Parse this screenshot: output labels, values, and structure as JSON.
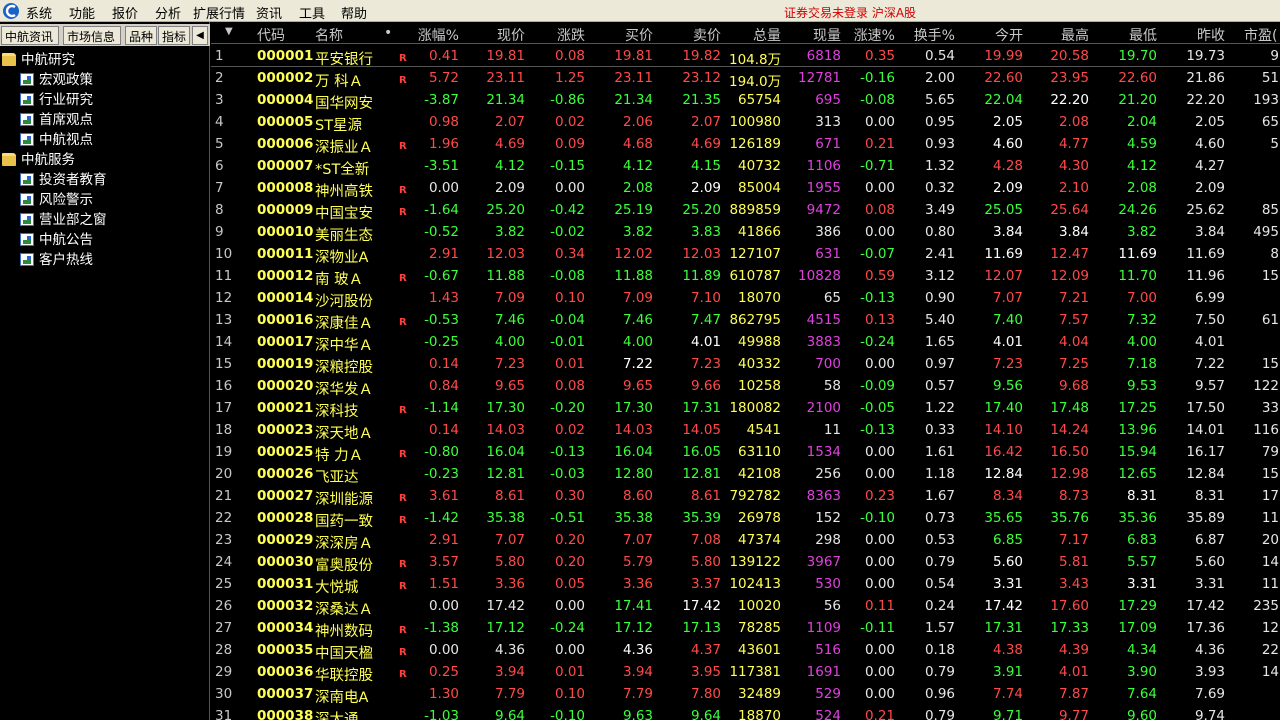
{
  "menubar": {
    "items": [
      "系统",
      "功能",
      "报价",
      "分析",
      "扩展行情",
      "资讯",
      "工具",
      "帮助"
    ],
    "status_text": "证券交易未登录  沪深A股"
  },
  "left_panel": {
    "tabs": [
      "中航资讯",
      "市场信息",
      "品种",
      "指标"
    ],
    "scroll_arrow": "◀",
    "tree": [
      {
        "label": "中航研究",
        "level": 0,
        "icon": "folder-icon"
      },
      {
        "label": "宏观政策",
        "level": 1,
        "icon": "document-icon"
      },
      {
        "label": "行业研究",
        "level": 1,
        "icon": "document-icon"
      },
      {
        "label": "首席观点",
        "level": 1,
        "icon": "document-icon"
      },
      {
        "label": "中航视点",
        "level": 1,
        "icon": "document-icon"
      },
      {
        "label": "中航服务",
        "level": 0,
        "icon": "folder-icon"
      },
      {
        "label": "投资者教育",
        "level": 1,
        "icon": "document-icon"
      },
      {
        "label": "风险警示",
        "level": 1,
        "icon": "document-icon"
      },
      {
        "label": "营业部之窗",
        "level": 1,
        "icon": "document-icon"
      },
      {
        "label": "中航公告",
        "level": 1,
        "icon": "document-icon"
      },
      {
        "label": "客户热线",
        "level": 1,
        "icon": "document-icon"
      }
    ]
  },
  "grid": {
    "sort_indicator": "▼",
    "headers": [
      "代码",
      "名称",
      "•",
      "涨幅%",
      "现价",
      "涨跌",
      "买价",
      "卖价",
      "总量",
      "现量",
      "涨速%",
      "换手%",
      "今开",
      "最高",
      "最低",
      "昨收",
      "市盈("
    ],
    "rows": [
      {
        "idx": "1",
        "code": "000001",
        "name": "平安银行",
        "mark": "R",
        "pct": "0.41",
        "price": "19.81",
        "chg": "0.08",
        "bid": "19.81",
        "ask": "19.82",
        "vol": "104.8万",
        "cur": "6818",
        "speed": "0.35",
        "turn": "0.54",
        "open": "19.99",
        "high": "20.58",
        "low": "19.70",
        "prev": "19.73",
        "pe": "9"
      },
      {
        "idx": "2",
        "code": "000002",
        "name": "万 科Ａ",
        "mark": "R",
        "pct": "5.72",
        "price": "23.11",
        "chg": "1.25",
        "bid": "23.11",
        "ask": "23.12",
        "vol": "194.0万",
        "cur": "12781",
        "speed": "-0.16",
        "turn": "2.00",
        "open": "22.60",
        "high": "23.95",
        "low": "22.60",
        "prev": "21.86",
        "pe": "51"
      },
      {
        "idx": "3",
        "code": "000004",
        "name": "国华网安",
        "mark": "",
        "pct": "-3.87",
        "price": "21.34",
        "chg": "-0.86",
        "bid": "21.34",
        "ask": "21.35",
        "vol": "65754",
        "cur": "695",
        "speed": "-0.08",
        "turn": "5.65",
        "open": "22.04",
        "high": "22.20",
        "low": "21.20",
        "prev": "22.20",
        "pe": "193"
      },
      {
        "idx": "4",
        "code": "000005",
        "name": "ST星源",
        "mark": "",
        "pct": "0.98",
        "price": "2.07",
        "chg": "0.02",
        "bid": "2.06",
        "ask": "2.07",
        "vol": "100980",
        "cur": "313",
        "speed": "0.00",
        "turn": "0.95",
        "open": "2.05",
        "high": "2.08",
        "low": "2.04",
        "prev": "2.05",
        "pe": "65"
      },
      {
        "idx": "5",
        "code": "000006",
        "name": "深振业Ａ",
        "mark": "R",
        "pct": "1.96",
        "price": "4.69",
        "chg": "0.09",
        "bid": "4.68",
        "ask": "4.69",
        "vol": "126189",
        "cur": "671",
        "speed": "0.21",
        "turn": "0.93",
        "open": "4.60",
        "high": "4.77",
        "low": "4.59",
        "prev": "4.60",
        "pe": "5"
      },
      {
        "idx": "6",
        "code": "000007",
        "name": "*ST全新",
        "mark": "",
        "pct": "-3.51",
        "price": "4.12",
        "chg": "-0.15",
        "bid": "4.12",
        "ask": "4.15",
        "vol": "40732",
        "cur": "1106",
        "speed": "-0.71",
        "turn": "1.32",
        "open": "4.28",
        "high": "4.30",
        "low": "4.12",
        "prev": "4.27",
        "pe": ""
      },
      {
        "idx": "7",
        "code": "000008",
        "name": "神州高铁",
        "mark": "R",
        "pct": "0.00",
        "price": "2.09",
        "chg": "0.00",
        "bid": "2.08",
        "ask": "2.09",
        "vol": "85004",
        "cur": "1955",
        "speed": "0.00",
        "turn": "0.32",
        "open": "2.09",
        "high": "2.10",
        "low": "2.08",
        "prev": "2.09",
        "pe": ""
      },
      {
        "idx": "8",
        "code": "000009",
        "name": "中国宝安",
        "mark": "R",
        "pct": "-1.64",
        "price": "25.20",
        "chg": "-0.42",
        "bid": "25.19",
        "ask": "25.20",
        "vol": "889859",
        "cur": "9472",
        "speed": "0.08",
        "turn": "3.49",
        "open": "25.05",
        "high": "25.64",
        "low": "24.26",
        "prev": "25.62",
        "pe": "85"
      },
      {
        "idx": "9",
        "code": "000010",
        "name": "美丽生态",
        "mark": "",
        "pct": "-0.52",
        "price": "3.82",
        "chg": "-0.02",
        "bid": "3.82",
        "ask": "3.83",
        "vol": "41866",
        "cur": "386",
        "speed": "0.00",
        "turn": "0.80",
        "open": "3.84",
        "high": "3.84",
        "low": "3.82",
        "prev": "3.84",
        "pe": "495"
      },
      {
        "idx": "10",
        "code": "000011",
        "name": "深物业A",
        "mark": "",
        "pct": "2.91",
        "price": "12.03",
        "chg": "0.34",
        "bid": "12.02",
        "ask": "12.03",
        "vol": "127107",
        "cur": "631",
        "speed": "-0.07",
        "turn": "2.41",
        "open": "11.69",
        "high": "12.47",
        "low": "11.69",
        "prev": "11.69",
        "pe": "8"
      },
      {
        "idx": "11",
        "code": "000012",
        "name": "南 玻Ａ",
        "mark": "R",
        "pct": "-0.67",
        "price": "11.88",
        "chg": "-0.08",
        "bid": "11.88",
        "ask": "11.89",
        "vol": "610787",
        "cur": "10828",
        "speed": "0.59",
        "turn": "3.12",
        "open": "12.07",
        "high": "12.09",
        "low": "11.70",
        "prev": "11.96",
        "pe": "15"
      },
      {
        "idx": "12",
        "code": "000014",
        "name": "沙河股份",
        "mark": "",
        "pct": "1.43",
        "price": "7.09",
        "chg": "0.10",
        "bid": "7.09",
        "ask": "7.10",
        "vol": "18070",
        "cur": "65",
        "speed": "-0.13",
        "turn": "0.90",
        "open": "7.07",
        "high": "7.21",
        "low": "7.00",
        "prev": "6.99",
        "pe": ""
      },
      {
        "idx": "13",
        "code": "000016",
        "name": "深康佳Ａ",
        "mark": "R",
        "pct": "-0.53",
        "price": "7.46",
        "chg": "-0.04",
        "bid": "7.46",
        "ask": "7.47",
        "vol": "862795",
        "cur": "4515",
        "speed": "0.13",
        "turn": "5.40",
        "open": "7.40",
        "high": "7.57",
        "low": "7.32",
        "prev": "7.50",
        "pe": "61"
      },
      {
        "idx": "14",
        "code": "000017",
        "name": "深中华Ａ",
        "mark": "",
        "pct": "-0.25",
        "price": "4.00",
        "chg": "-0.01",
        "bid": "4.00",
        "ask": "4.01",
        "vol": "49988",
        "cur": "3883",
        "speed": "-0.24",
        "turn": "1.65",
        "open": "4.01",
        "high": "4.04",
        "low": "4.00",
        "prev": "4.01",
        "pe": ""
      },
      {
        "idx": "15",
        "code": "000019",
        "name": "深粮控股",
        "mark": "",
        "pct": "0.14",
        "price": "7.23",
        "chg": "0.01",
        "bid": "7.22",
        "ask": "7.23",
        "vol": "40332",
        "cur": "700",
        "speed": "0.00",
        "turn": "0.97",
        "open": "7.23",
        "high": "7.25",
        "low": "7.18",
        "prev": "7.22",
        "pe": "15"
      },
      {
        "idx": "16",
        "code": "000020",
        "name": "深华发Ａ",
        "mark": "",
        "pct": "0.84",
        "price": "9.65",
        "chg": "0.08",
        "bid": "9.65",
        "ask": "9.66",
        "vol": "10258",
        "cur": "58",
        "speed": "-0.09",
        "turn": "0.57",
        "open": "9.56",
        "high": "9.68",
        "low": "9.53",
        "prev": "9.57",
        "pe": "122"
      },
      {
        "idx": "17",
        "code": "000021",
        "name": "深科技",
        "mark": "R",
        "pct": "-1.14",
        "price": "17.30",
        "chg": "-0.20",
        "bid": "17.30",
        "ask": "17.31",
        "vol": "180082",
        "cur": "2100",
        "speed": "-0.05",
        "turn": "1.22",
        "open": "17.40",
        "high": "17.48",
        "low": "17.25",
        "prev": "17.50",
        "pe": "33"
      },
      {
        "idx": "18",
        "code": "000023",
        "name": "深天地Ａ",
        "mark": "",
        "pct": "0.14",
        "price": "14.03",
        "chg": "0.02",
        "bid": "14.03",
        "ask": "14.05",
        "vol": "4541",
        "cur": "11",
        "speed": "-0.13",
        "turn": "0.33",
        "open": "14.10",
        "high": "14.24",
        "low": "13.96",
        "prev": "14.01",
        "pe": "116"
      },
      {
        "idx": "19",
        "code": "000025",
        "name": "特 力Ａ",
        "mark": "R",
        "pct": "-0.80",
        "price": "16.04",
        "chg": "-0.13",
        "bid": "16.04",
        "ask": "16.05",
        "vol": "63110",
        "cur": "1534",
        "speed": "0.00",
        "turn": "1.61",
        "open": "16.42",
        "high": "16.50",
        "low": "15.94",
        "prev": "16.17",
        "pe": "79"
      },
      {
        "idx": "20",
        "code": "000026",
        "name": "飞亚达",
        "mark": "",
        "pct": "-0.23",
        "price": "12.81",
        "chg": "-0.03",
        "bid": "12.80",
        "ask": "12.81",
        "vol": "42108",
        "cur": "256",
        "speed": "0.00",
        "turn": "1.18",
        "open": "12.84",
        "high": "12.98",
        "low": "12.65",
        "prev": "12.84",
        "pe": "15"
      },
      {
        "idx": "21",
        "code": "000027",
        "name": "深圳能源",
        "mark": "R",
        "pct": "3.61",
        "price": "8.61",
        "chg": "0.30",
        "bid": "8.60",
        "ask": "8.61",
        "vol": "792782",
        "cur": "8363",
        "speed": "0.23",
        "turn": "1.67",
        "open": "8.34",
        "high": "8.73",
        "low": "8.31",
        "prev": "8.31",
        "pe": "17"
      },
      {
        "idx": "22",
        "code": "000028",
        "name": "国药一致",
        "mark": "R",
        "pct": "-1.42",
        "price": "35.38",
        "chg": "-0.51",
        "bid": "35.38",
        "ask": "35.39",
        "vol": "26978",
        "cur": "152",
        "speed": "-0.10",
        "turn": "0.73",
        "open": "35.65",
        "high": "35.76",
        "low": "35.36",
        "prev": "35.89",
        "pe": "11"
      },
      {
        "idx": "23",
        "code": "000029",
        "name": "深深房Ａ",
        "mark": "",
        "pct": "2.91",
        "price": "7.07",
        "chg": "0.20",
        "bid": "7.07",
        "ask": "7.08",
        "vol": "47374",
        "cur": "298",
        "speed": "0.00",
        "turn": "0.53",
        "open": "6.85",
        "high": "7.17",
        "low": "6.83",
        "prev": "6.87",
        "pe": "20"
      },
      {
        "idx": "24",
        "code": "000030",
        "name": "富奥股份",
        "mark": "R",
        "pct": "3.57",
        "price": "5.80",
        "chg": "0.20",
        "bid": "5.79",
        "ask": "5.80",
        "vol": "139122",
        "cur": "3967",
        "speed": "0.00",
        "turn": "0.79",
        "open": "5.60",
        "high": "5.81",
        "low": "5.57",
        "prev": "5.60",
        "pe": "14"
      },
      {
        "idx": "25",
        "code": "000031",
        "name": "大悦城",
        "mark": "R",
        "pct": "1.51",
        "price": "3.36",
        "chg": "0.05",
        "bid": "3.36",
        "ask": "3.37",
        "vol": "102413",
        "cur": "530",
        "speed": "0.00",
        "turn": "0.54",
        "open": "3.31",
        "high": "3.43",
        "low": "3.31",
        "prev": "3.31",
        "pe": "11"
      },
      {
        "idx": "26",
        "code": "000032",
        "name": "深桑达Ａ",
        "mark": "",
        "pct": "0.00",
        "price": "17.42",
        "chg": "0.00",
        "bid": "17.41",
        "ask": "17.42",
        "vol": "10020",
        "cur": "56",
        "speed": "0.11",
        "turn": "0.24",
        "open": "17.42",
        "high": "17.60",
        "low": "17.29",
        "prev": "17.42",
        "pe": "235"
      },
      {
        "idx": "27",
        "code": "000034",
        "name": "神州数码",
        "mark": "R",
        "pct": "-1.38",
        "price": "17.12",
        "chg": "-0.24",
        "bid": "17.12",
        "ask": "17.13",
        "vol": "78285",
        "cur": "1109",
        "speed": "-0.11",
        "turn": "1.57",
        "open": "17.31",
        "high": "17.33",
        "low": "17.09",
        "prev": "17.36",
        "pe": "12"
      },
      {
        "idx": "28",
        "code": "000035",
        "name": "中国天楹",
        "mark": "R",
        "pct": "0.00",
        "price": "4.36",
        "chg": "0.00",
        "bid": "4.36",
        "ask": "4.37",
        "vol": "43601",
        "cur": "516",
        "speed": "0.00",
        "turn": "0.18",
        "open": "4.38",
        "high": "4.39",
        "low": "4.34",
        "prev": "4.36",
        "pe": "22"
      },
      {
        "idx": "29",
        "code": "000036",
        "name": "华联控股",
        "mark": "R",
        "pct": "0.25",
        "price": "3.94",
        "chg": "0.01",
        "bid": "3.94",
        "ask": "3.95",
        "vol": "117381",
        "cur": "1691",
        "speed": "0.00",
        "turn": "0.79",
        "open": "3.91",
        "high": "4.01",
        "low": "3.90",
        "prev": "3.93",
        "pe": "14"
      },
      {
        "idx": "30",
        "code": "000037",
        "name": "深南电A",
        "mark": "",
        "pct": "1.30",
        "price": "7.79",
        "chg": "0.10",
        "bid": "7.79",
        "ask": "7.80",
        "vol": "32489",
        "cur": "529",
        "speed": "0.00",
        "turn": "0.96",
        "open": "7.74",
        "high": "7.87",
        "low": "7.64",
        "prev": "7.69",
        "pe": ""
      },
      {
        "idx": "31",
        "code": "000038",
        "name": "深大通",
        "mark": "",
        "pct": "-1.03",
        "price": "9.64",
        "chg": "-0.10",
        "bid": "9.63",
        "ask": "9.64",
        "vol": "18870",
        "cur": "524",
        "speed": "0.21",
        "turn": "0.79",
        "open": "9.71",
        "high": "9.77",
        "low": "9.60",
        "prev": "9.74",
        "pe": ""
      }
    ]
  },
  "colors": {
    "up": "#ff4a4a",
    "down": "#3cff3c",
    "flat": "#e6e6e6",
    "code": "#ffff54",
    "volume_magenta": "#e040e0"
  }
}
